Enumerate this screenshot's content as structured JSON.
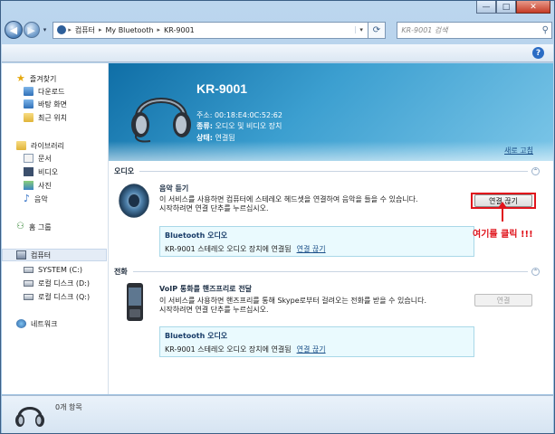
{
  "window": {
    "minimize_glyph": "—",
    "maximize_glyph": "□",
    "close_glyph": "✕"
  },
  "address_bar": {
    "crumbs": [
      "컴퓨터",
      "My Bluetooth",
      "KR-9001"
    ],
    "search_placeholder": "KR-9001 검색"
  },
  "nav": {
    "favorites": "즐겨찾기",
    "downloads": "다운로드",
    "desktop": "바탕 화면",
    "recent": "최근 위치",
    "libraries": "라이브러리",
    "documents": "문서",
    "videos": "비디오",
    "pictures": "사진",
    "music": "음악",
    "homegroup": "홈 그룹",
    "computer": "컴퓨터",
    "drive_c": "SYSTEM (C:)",
    "drive_d": "로컬 디스크 (D:)",
    "drive_q": "로컬 디스크 (Q:)",
    "network": "네트워크"
  },
  "device": {
    "name": "KR-9001",
    "address": "주소: 00:18:E4:0C:52:62",
    "type": "오디오 및 비디오 장치",
    "type_label": "종류:",
    "status": "연결됨",
    "status_label": "상태:",
    "refresh_link": "새로 고침"
  },
  "groups": {
    "audio": "오디오",
    "phone": "전화"
  },
  "services": {
    "music": {
      "title": "음악 듣기",
      "desc1": "이 서비스를 사용하면 컴퓨터에 스테레오 헤드셋을 연결하여 음악을 들을 수 있습니다.",
      "desc2": "시작하려면 연결 단추를 누르십시오.",
      "button": "연결 끊기",
      "box_title": "Bluetooth 오디오",
      "box_text": "KR-9001 스테레오 오디오 장치에 연결됨",
      "box_link": "연결 끊기"
    },
    "voip": {
      "title": "VoIP 통화를 핸즈프리로 전달",
      "desc1": "이 서비스를 사용하면 핸즈프리를 통해 Skype로부터 걸려오는 전화를 받을 수 있습니다.",
      "desc2": "시작하려면 연결 단추를 누르십시오.",
      "button": "연결",
      "box_title": "Bluetooth 오디오",
      "box_text": "KR-9001 스테레오 오디오 장치에 연결됨",
      "box_link": "연결 끊기"
    }
  },
  "annotation": {
    "callout": "여기를 클릭 !!!"
  },
  "details": {
    "count": "0개 항목"
  }
}
